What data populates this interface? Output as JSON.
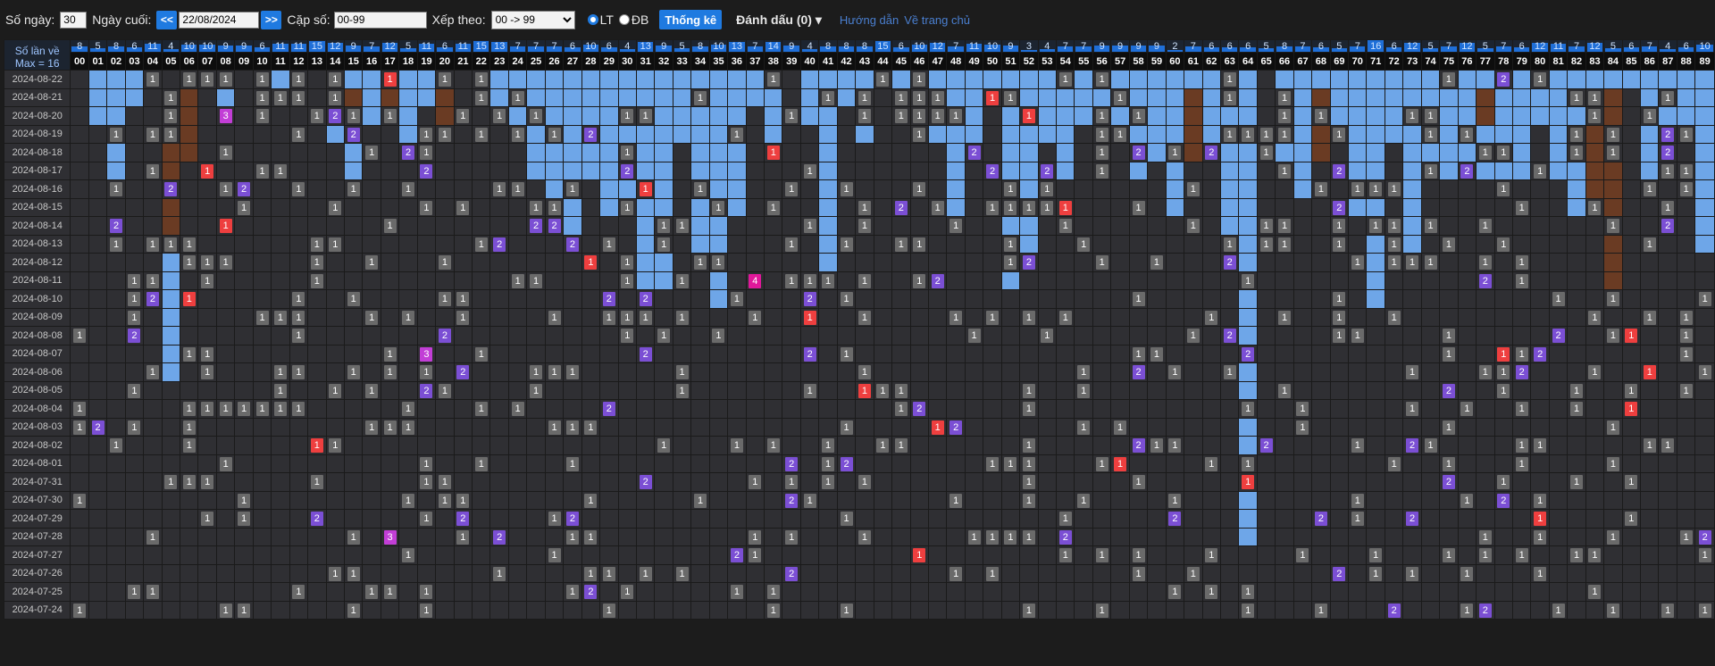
{
  "toolbar": {
    "so_ngay_label": "Số ngày:",
    "so_ngay_value": "30",
    "ngay_cuoi_label": "Ngày cuối:",
    "prev_label": "<<",
    "date_value": "22/08/2024",
    "next_label": ">>",
    "cap_so_label": "Cặp số:",
    "cap_so_value": "00-99",
    "xep_theo_label": "Xếp theo:",
    "xep_theo_value": "00 -> 99",
    "radio_lt": "LT",
    "radio_db": "ĐB",
    "thong_ke_label": "Thống kê",
    "danh_dau_label": "Đánh dấu (0) ▾",
    "huong_dan_label": "Hướng dẫn",
    "ve_trang_chu_label": "Về trang chủ"
  },
  "corner": {
    "line1": "Số lần về",
    "line2": "Max = 16"
  },
  "max_count": 16,
  "counts": [
    8,
    5,
    8,
    6,
    11,
    4,
    10,
    10,
    9,
    9,
    6,
    11,
    11,
    15,
    12,
    9,
    7,
    12,
    5,
    11,
    6,
    11,
    15,
    13,
    7,
    7,
    7,
    6,
    10,
    6,
    4,
    13,
    9,
    5,
    8,
    10,
    13,
    7,
    14,
    9,
    4,
    8,
    8,
    8,
    15,
    6,
    10,
    12,
    7,
    11,
    10,
    9,
    3,
    4,
    7,
    7,
    9,
    9,
    9,
    9,
    2,
    7,
    6,
    6,
    6,
    5,
    8,
    7,
    6,
    5,
    7,
    16,
    6,
    12,
    5,
    7,
    12,
    5,
    7,
    6,
    12,
    11,
    7,
    12,
    5,
    6,
    7,
    4,
    6,
    10
  ],
  "numbers": [
    "00",
    "01",
    "02",
    "03",
    "04",
    "05",
    "06",
    "07",
    "08",
    "09",
    "10",
    "11",
    "12",
    "13",
    "14",
    "15",
    "16",
    "17",
    "18",
    "19",
    "20",
    "21",
    "22",
    "23",
    "24",
    "25",
    "26",
    "27",
    "28",
    "29",
    "30",
    "31",
    "32",
    "33",
    "34",
    "35",
    "36",
    "37",
    "38",
    "39",
    "40",
    "41",
    "42",
    "43",
    "44",
    "45",
    "46",
    "47",
    "48",
    "49",
    "50",
    "51",
    "52",
    "53",
    "54",
    "55",
    "56",
    "57",
    "58",
    "59",
    "60",
    "61",
    "62",
    "63",
    "64",
    "65",
    "66",
    "67",
    "68",
    "69",
    "70",
    "71",
    "72",
    "73",
    "74",
    "75",
    "76",
    "77",
    "78",
    "79",
    "80",
    "81",
    "82",
    "83",
    "84",
    "85",
    "86",
    "87",
    "88",
    "89"
  ],
  "dates": [
    "2024-08-22",
    "2024-08-21",
    "2024-08-20",
    "2024-08-19",
    "2024-08-18",
    "2024-08-17",
    "2024-08-16",
    "2024-08-15",
    "2024-08-14",
    "2024-08-13",
    "2024-08-12",
    "2024-08-11",
    "2024-08-10",
    "2024-08-09",
    "2024-08-08",
    "2024-08-07",
    "2024-08-06",
    "2024-08-05",
    "2024-08-04",
    "2024-08-03",
    "2024-08-02",
    "2024-08-01",
    "2024-07-31",
    "2024-07-30",
    "2024-07-29",
    "2024-07-28",
    "2024-07-27",
    "2024-07-26",
    "2024-07-25",
    "2024-07-24"
  ],
  "grid": [
    "....1.111.1.1.1..r..1.1...............1.....1.1.......1.1......1...........1..2.1...........1",
    ".....1....111.1.......1.1.........1......1.1.111..r1.....1.....1..1...............11...1...1",
    ".....1..3.1..121.1...1.1.1....11.......1...1.1111...r...1.1.......1.1....11........1..1...1.",
    "..1.11......1..2...11.1.1.1.2.......1.........1.........11.....1111..1....1.1.....1.1..21..1",
    "........1.......1.21..........1.......r..........2......1.2.1.2..1...........11...1.1..2..11.",
    "....1..r..11.......2..........2.........1.........2..2..1.........1..2....1.2...1......11.1..",
    "..1..2..12..1..1..1....11..1...r..1....1..1...1....1.1.......1......1.111.....1.......1.1..1.",
    ".........1....1....1.1...11...1....1..1....1.2.1..1111r...1..........2.........1...1...1..1.12..1",
    "..2.....r........1.......22.....11......1..1....1.....1......1...11..1.11.1..1......1..2.....",
    "..1.111......11.......12...2.1..1......1..1..11....1...1.......1.11..1..1..1..1.......1.....",
    "......111....1..1...1.......r.1...11...............12...1..1...2......1.111..1.1...........",
    "...11..1.....1..........11....1..1...4.111.1..12................1............2.1......",
    "...12.r.....1..1....11.......2.2....1...2.1...............1..........1...........1..1....1",
    "...1......111...1.1..1....1..111.1...1..r..1....1.1.1.1.......1...1..1..1..........1..1.1.1",
    "1..2........1.......2.........1.1..1.............1...1.......1.2.....11....1.....2..1r..1.1",
    "......11.........1.3..1........2........2.1...............11....2..........1..r12.......1.1..1",
    "....1..1...11..1.1.1.2...111.....1.........1...........1..2.1..1.........1...112...1..r..1",
    "...1.......1..1.1..21....1.......1......1..r11......1..1..........1........2..1...1..1..1....",
    "1.....1111111.....1...1.1....2...............12.....1...........1..1.....1..1..1..1..r.....",
    "12.1..1.........111.......111.............1....r2......1.1.........1.......1........1.....",
    "..1...1......r1.................1...1.1..1..11......1.....211....2....1..21....11.....11.",
    "........1..........1..1....1...........2.12.......111...1r....1.1.......1..1...1....1.....",
    ".....111.....1.....11..........2.....1.1.1.1........1.....1.....r..........2..1...1..1.",
    "1........1........1.11......1.....1....21.......1...1..1....1.........1.....1.2.1...........1",
    ".......1.1...2.....1.2....12..............1...........1.....2.......2.1..2......r....1......",
    "....1..........1.3...1.2...11........1.1...1.....1111.2......................1..1...1...12",
    "..................1.......1.........21........r.......1.1.1...1....1...1...1.1.1..11.....1.1",
    "..............11.......1....11.1.1.....2........1.1.......1..1.......2.1.1..1...1.........1",
    "...11.......1...11.1.......12.1.....1.1.....................1.1.1..................1.......2..1.",
    "1.......11.....1...1.........1........1...1.........1...1.......1...1...2...12...1..1..1.1"
  ],
  "gaps": {
    "blue": [
      [
        1,
        0,
        2
      ],
      [
        2,
        0,
        5
      ],
      [
        3,
        0,
        1
      ],
      [
        4,
        0,
        0
      ],
      [
        5,
        2,
        16
      ],
      [
        8,
        0,
        1
      ],
      [
        11,
        0,
        0
      ],
      [
        14,
        0,
        3
      ],
      [
        15,
        0,
        6
      ],
      [
        16,
        0,
        2
      ],
      [
        17,
        0,
        1
      ],
      [
        18,
        0,
        4
      ],
      [
        19,
        0,
        1
      ],
      [
        20,
        0,
        2
      ],
      [
        23,
        0,
        2
      ],
      [
        24,
        0,
        2
      ],
      [
        25,
        0,
        5
      ],
      [
        26,
        0,
        8
      ],
      [
        27,
        0,
        9
      ],
      [
        28,
        0,
        5
      ],
      [
        29,
        0,
        7
      ],
      [
        30,
        0,
        6
      ],
      [
        31,
        0,
        12
      ],
      [
        32,
        0,
        11
      ],
      [
        33,
        0,
        3
      ],
      [
        34,
        0,
        9
      ],
      [
        35,
        0,
        12
      ],
      [
        36,
        0,
        7
      ],
      [
        37,
        0,
        1
      ],
      [
        38,
        0,
        4
      ],
      [
        40,
        0,
        2
      ],
      [
        41,
        0,
        10
      ],
      [
        42,
        0,
        1
      ],
      [
        43,
        0,
        3
      ],
      [
        45,
        0,
        1
      ],
      [
        46,
        0,
        2
      ],
      [
        47,
        0,
        3
      ],
      [
        48,
        0,
        7
      ],
      [
        49,
        0,
        3
      ],
      [
        50,
        0,
        1
      ],
      [
        51,
        0,
        11
      ],
      [
        52,
        0,
        9
      ],
      [
        53,
        0,
        3
      ],
      [
        54,
        0,
        5
      ],
      [
        55,
        0,
        2
      ],
      [
        56,
        0,
        1
      ],
      [
        57,
        0,
        3
      ],
      [
        58,
        0,
        5
      ],
      [
        59,
        0,
        4
      ],
      [
        60,
        0,
        7
      ],
      [
        61,
        0,
        3
      ],
      [
        62,
        0,
        4
      ],
      [
        63,
        0,
        8
      ],
      [
        64,
        0,
        25
      ],
      [
        66,
        0,
        4
      ],
      [
        67,
        0,
        6
      ],
      [
        68,
        0,
        2
      ],
      [
        69,
        0,
        3
      ],
      [
        70,
        0,
        7
      ],
      [
        71,
        0,
        12
      ],
      [
        72,
        0,
        3
      ],
      [
        73,
        0,
        9
      ],
      [
        74,
        0,
        5
      ],
      [
        75,
        0,
        5
      ],
      [
        76,
        0,
        5
      ],
      [
        77,
        0,
        5
      ],
      [
        78,
        0,
        6
      ],
      [
        79,
        0,
        5
      ],
      [
        80,
        0,
        2
      ],
      [
        81,
        0,
        5
      ],
      [
        82,
        0,
        7
      ],
      [
        83,
        0,
        3
      ],
      [
        84,
        0,
        4
      ],
      [
        85,
        0,
        0
      ],
      [
        86,
        0,
        5
      ],
      [
        87,
        0,
        3
      ],
      [
        88,
        0,
        2
      ],
      [
        89,
        0,
        9
      ],
      [
        90,
        0,
        4
      ],
      [
        91,
        0,
        8
      ],
      [
        92,
        0,
        7
      ]
    ],
    "brown": [
      [
        5,
        2,
        9
      ],
      [
        6,
        1,
        4
      ],
      [
        15,
        1,
        3
      ],
      [
        17,
        1,
        2
      ],
      [
        20,
        1,
        3
      ],
      [
        61,
        1,
        4
      ],
      [
        68,
        1,
        4
      ],
      [
        77,
        1,
        2
      ],
      [
        83,
        1,
        7
      ],
      [
        84,
        1,
        11
      ],
      [
        90,
        1,
        4
      ]
    ]
  }
}
